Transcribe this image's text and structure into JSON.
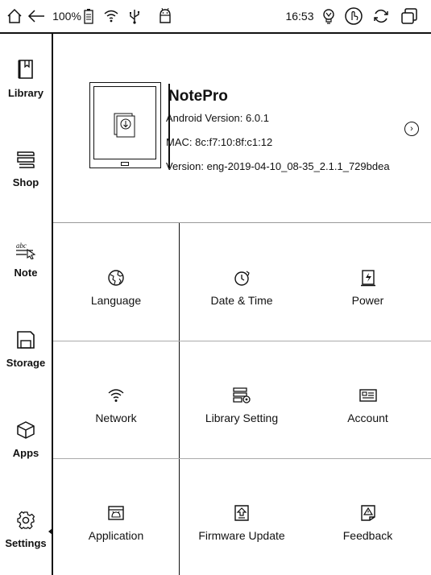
{
  "statusbar": {
    "battery_text": "100%",
    "time": "16:53",
    "icons": [
      "home-icon",
      "back-icon",
      "battery-icon",
      "wifi-icon",
      "usb-icon",
      "android-icon",
      "lightbulb-icon",
      "touch-icon",
      "refresh-icon",
      "recent-apps-icon"
    ]
  },
  "sidebar": {
    "items": [
      {
        "label": "Library",
        "icon": "library-icon"
      },
      {
        "label": "Shop",
        "icon": "shop-icon"
      },
      {
        "label": "Note",
        "icon": "note-icon"
      },
      {
        "label": "Storage",
        "icon": "storage-icon"
      },
      {
        "label": "Apps",
        "icon": "apps-icon"
      },
      {
        "label": "Settings",
        "icon": "settings-icon"
      }
    ],
    "active": "Settings"
  },
  "device": {
    "name": "NotePro",
    "android_version": "Android Version: 6.0.1",
    "mac": "MAC: 8c:f7:10:8f:c1:12",
    "version": "Version: eng-2019-04-10_08-35_2.1.1_729bdea"
  },
  "settings_grid": [
    {
      "label": "Language",
      "icon": "language-icon"
    },
    {
      "label": "Date & Time",
      "icon": "clock-icon"
    },
    {
      "label": "Power",
      "icon": "power-icon"
    },
    {
      "label": "Network",
      "icon": "wifi-icon"
    },
    {
      "label": "Library Setting",
      "icon": "library-setting-icon"
    },
    {
      "label": "Account",
      "icon": "account-icon"
    },
    {
      "label": "Application",
      "icon": "application-icon"
    },
    {
      "label": "Firmware Update",
      "icon": "firmware-update-icon"
    },
    {
      "label": "Feedback",
      "icon": "feedback-icon"
    }
  ]
}
